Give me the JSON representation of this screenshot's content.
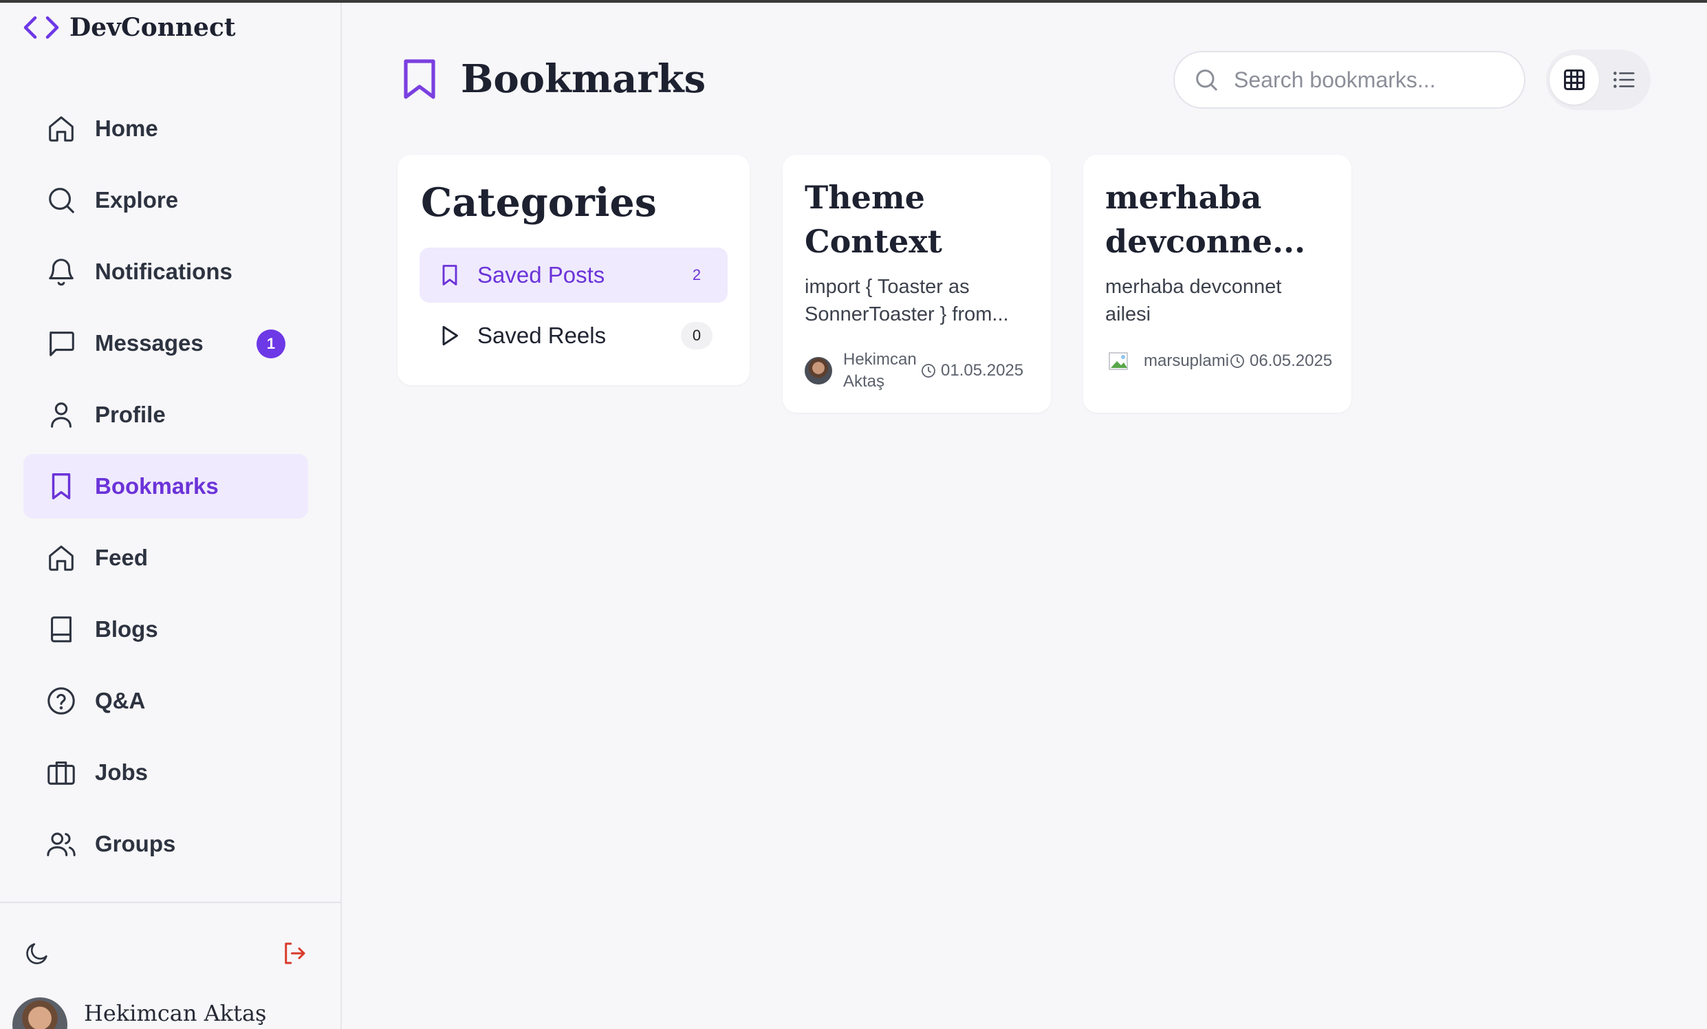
{
  "brand": {
    "name": "DevConnect",
    "accent": "#6d38e6"
  },
  "nav": {
    "items": [
      {
        "label": "Home",
        "icon": "home-icon"
      },
      {
        "label": "Explore",
        "icon": "search-icon"
      },
      {
        "label": "Notifications",
        "icon": "bell-icon"
      },
      {
        "label": "Messages",
        "icon": "message-icon",
        "badge": "1"
      },
      {
        "label": "Profile",
        "icon": "user-icon"
      },
      {
        "label": "Bookmarks",
        "icon": "bookmark-icon",
        "active": true
      },
      {
        "label": "Feed",
        "icon": "home-icon"
      },
      {
        "label": "Blogs",
        "icon": "book-icon"
      },
      {
        "label": "Q&A",
        "icon": "help-circle-icon"
      },
      {
        "label": "Jobs",
        "icon": "briefcase-icon"
      },
      {
        "label": "Groups",
        "icon": "users-icon"
      }
    ]
  },
  "footer": {
    "user_name": "Hekimcan Aktaş",
    "logout_color": "#d93a2b"
  },
  "header": {
    "title": "Bookmarks",
    "search_placeholder": "Search bookmarks...",
    "view_mode": "grid"
  },
  "categories": {
    "title": "Categories",
    "items": [
      {
        "label": "Saved Posts",
        "count": "2",
        "icon": "bookmark-icon",
        "active": true
      },
      {
        "label": "Saved Reels",
        "count": "0",
        "icon": "play-icon"
      }
    ]
  },
  "posts": [
    {
      "title": "Theme Context",
      "excerpt": "import { Toaster as SonnerToaster } from...",
      "author": "Hekimcan Aktaş",
      "date": "01.05.2025"
    },
    {
      "title": "merhaba devconne...",
      "excerpt": "merhaba devconnet ailesi",
      "author": "marsuplami",
      "date": "06.05.2025"
    }
  ]
}
